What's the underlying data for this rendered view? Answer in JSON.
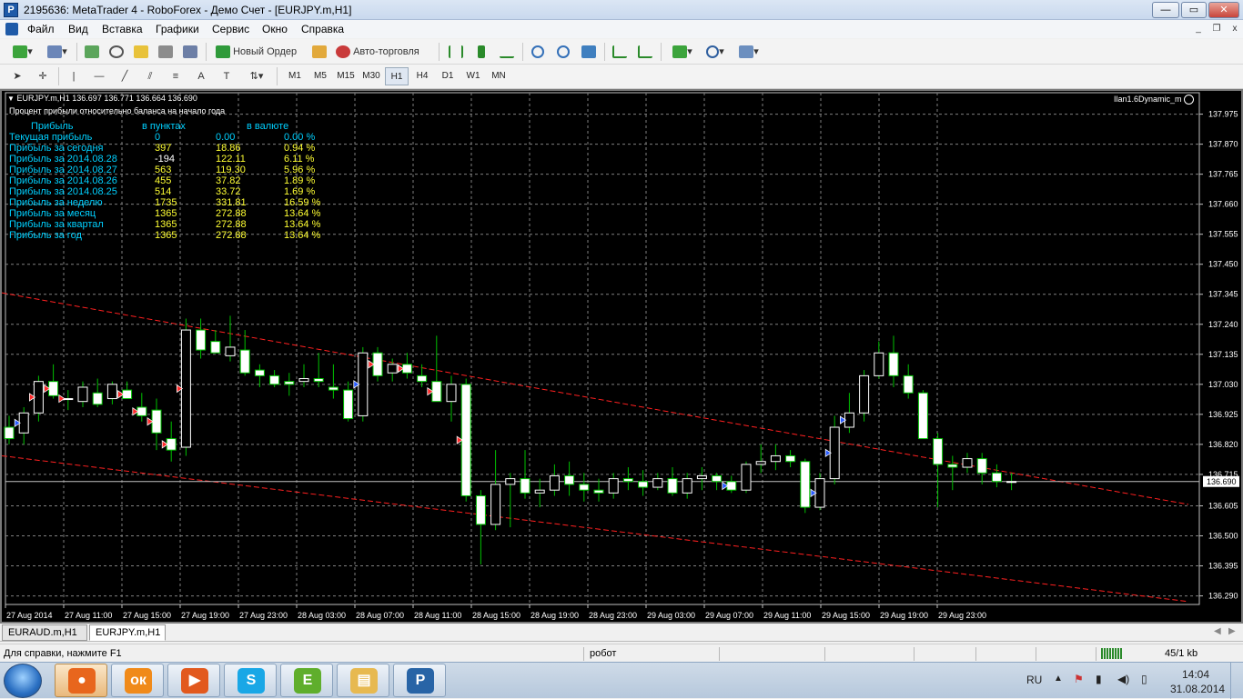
{
  "window": {
    "title": "2195636: MetaTrader 4 - RoboForex - Демо Счет - [EURJPY.m,H1]",
    "app_icon_glyph": "P",
    "minimize_glyph": "—",
    "maximize_glyph": "▭",
    "close_glyph": "✕",
    "mdi_minimize": "_",
    "mdi_restore": "❐",
    "mdi_close": "x"
  },
  "menu": [
    "Файл",
    "Вид",
    "Вставка",
    "Графики",
    "Сервис",
    "Окно",
    "Справка"
  ],
  "toolbar": {
    "new_order": "Новый Ордер",
    "auto_trading": "Авто-торговля",
    "timeframes": [
      "M1",
      "M5",
      "M15",
      "M30",
      "H1",
      "H4",
      "D1",
      "W1",
      "MN"
    ],
    "active_timeframe": "H1",
    "search_value": ""
  },
  "chart": {
    "info_line": "EURJPY.m,H1  136.697 136.771 136.664 136.690",
    "indicator_title": "Процент прибыли относительно баланса на начало года",
    "expert_label": "Ilan1.6Dynamic_m",
    "current_price_label": "136.690"
  },
  "profit_table": {
    "header": [
      "Прибыль",
      "в пунктах",
      "в валюте"
    ],
    "rows": [
      [
        "Текущая прибыль",
        "0",
        "0.00",
        "0.00 %"
      ],
      [
        "Прибыль за сегодня",
        "397",
        "18.86",
        "0.94 %"
      ],
      [
        "Прибыль за 2014.08.28",
        "-194",
        "122.11",
        "6.11 %"
      ],
      [
        "Прибыль за 2014.08.27",
        "563",
        "119.30",
        "5.96 %"
      ],
      [
        "Прибыль за 2014.08.26",
        "455",
        "37.82",
        "1.89 %"
      ],
      [
        "Прибыль за 2014.08.25",
        "514",
        "33.72",
        "1.69 %"
      ],
      [
        "Прибыль за неделю",
        "1735",
        "331.81",
        "16.59 %"
      ],
      [
        "Прибыль за месяц",
        "1365",
        "272.88",
        "13.64 %"
      ],
      [
        "Прибыль за квартал",
        "1365",
        "272.88",
        "13.64 %"
      ],
      [
        "Прибыль за год",
        "1365",
        "272.88",
        "13.64 %"
      ]
    ]
  },
  "chart_data": {
    "type": "candlestick",
    "symbol": "EURJPY.m",
    "timeframe": "H1",
    "y_ticks": [
      "137.975",
      "137.870",
      "137.765",
      "137.660",
      "137.555",
      "137.450",
      "137.345",
      "137.240",
      "137.135",
      "137.030",
      "136.925",
      "136.820",
      "136.715",
      "136.605",
      "136.500",
      "136.395",
      "136.290"
    ],
    "x_ticks": [
      "27 Aug 2014",
      "27 Aug 11:00",
      "27 Aug 15:00",
      "27 Aug 19:00",
      "27 Aug 23:00",
      "28 Aug 03:00",
      "28 Aug 07:00",
      "28 Aug 11:00",
      "28 Aug 15:00",
      "28 Aug 19:00",
      "28 Aug 23:00",
      "29 Aug 03:00",
      "29 Aug 07:00",
      "29 Aug 11:00",
      "29 Aug 15:00",
      "29 Aug 19:00",
      "29 Aug 23:00"
    ],
    "ylim": [
      136.26,
      138.05
    ],
    "grid": true,
    "current_price": 136.69,
    "candles": [
      [
        136.88,
        136.92,
        136.82,
        136.84
      ],
      [
        136.86,
        136.95,
        136.82,
        136.93
      ],
      [
        136.93,
        137.06,
        136.9,
        137.04
      ],
      [
        137.04,
        137.1,
        136.98,
        136.99
      ],
      [
        136.98,
        137.01,
        136.94,
        136.98
      ],
      [
        136.97,
        137.04,
        136.95,
        137.02
      ],
      [
        137.0,
        137.05,
        136.95,
        136.96
      ],
      [
        136.98,
        137.04,
        136.96,
        137.03
      ],
      [
        137.01,
        137.04,
        136.98,
        136.98
      ],
      [
        136.95,
        137.0,
        136.9,
        136.92
      ],
      [
        136.94,
        136.98,
        136.8,
        136.86
      ],
      [
        136.84,
        136.9,
        136.76,
        136.8
      ],
      [
        136.81,
        137.26,
        136.78,
        137.22
      ],
      [
        137.22,
        137.26,
        137.12,
        137.15
      ],
      [
        137.18,
        137.22,
        137.14,
        137.14
      ],
      [
        137.13,
        137.27,
        137.11,
        137.16
      ],
      [
        137.15,
        137.22,
        137.06,
        137.07
      ],
      [
        137.08,
        137.1,
        137.02,
        137.06
      ],
      [
        137.06,
        137.08,
        137.02,
        137.03
      ],
      [
        137.04,
        137.07,
        136.99,
        137.03
      ],
      [
        137.04,
        137.1,
        137.02,
        137.05
      ],
      [
        137.05,
        137.14,
        137.02,
        137.04
      ],
      [
        137.02,
        137.1,
        136.98,
        137.01
      ],
      [
        137.01,
        137.04,
        136.9,
        136.91
      ],
      [
        136.92,
        137.16,
        136.9,
        137.14
      ],
      [
        137.14,
        137.16,
        137.04,
        137.06
      ],
      [
        137.07,
        137.12,
        137.04,
        137.1
      ],
      [
        137.1,
        137.14,
        137.05,
        137.07
      ],
      [
        137.06,
        137.1,
        137.02,
        137.04
      ],
      [
        137.04,
        137.2,
        136.98,
        136.97
      ],
      [
        136.97,
        137.06,
        136.9,
        137.03
      ],
      [
        137.03,
        137.05,
        136.62,
        136.64
      ],
      [
        136.64,
        136.66,
        136.4,
        136.54
      ],
      [
        136.54,
        136.8,
        136.52,
        136.68
      ],
      [
        136.68,
        136.72,
        136.53,
        136.7
      ],
      [
        136.7,
        136.8,
        136.63,
        136.65
      ],
      [
        136.65,
        136.7,
        136.6,
        136.66
      ],
      [
        136.66,
        136.75,
        136.64,
        136.71
      ],
      [
        136.71,
        136.76,
        136.64,
        136.68
      ],
      [
        136.68,
        136.72,
        136.62,
        136.66
      ],
      [
        136.66,
        136.7,
        136.62,
        136.65
      ],
      [
        136.65,
        136.72,
        136.63,
        136.7
      ],
      [
        136.7,
        136.74,
        136.66,
        136.69
      ],
      [
        136.69,
        136.73,
        136.64,
        136.67
      ],
      [
        136.67,
        136.72,
        136.66,
        136.7
      ],
      [
        136.7,
        136.74,
        136.64,
        136.65
      ],
      [
        136.65,
        136.72,
        136.63,
        136.7
      ],
      [
        136.7,
        136.74,
        136.66,
        136.71
      ],
      [
        136.71,
        136.72,
        136.66,
        136.69
      ],
      [
        136.69,
        136.71,
        136.65,
        136.66
      ],
      [
        136.66,
        136.76,
        136.65,
        136.75
      ],
      [
        136.75,
        136.82,
        136.72,
        136.76
      ],
      [
        136.76,
        136.82,
        136.73,
        136.78
      ],
      [
        136.78,
        136.8,
        136.74,
        136.76
      ],
      [
        136.76,
        136.77,
        136.58,
        136.6
      ],
      [
        136.6,
        136.72,
        136.59,
        136.7
      ],
      [
        136.7,
        136.92,
        136.68,
        136.88
      ],
      [
        136.88,
        137.0,
        136.86,
        136.93
      ],
      [
        136.93,
        137.08,
        136.9,
        137.06
      ],
      [
        137.06,
        137.18,
        137.05,
        137.14
      ],
      [
        137.14,
        137.2,
        137.02,
        137.06
      ],
      [
        137.06,
        137.1,
        136.98,
        137.0
      ],
      [
        137.0,
        137.01,
        136.84,
        136.84
      ],
      [
        136.84,
        136.86,
        136.6,
        136.75
      ],
      [
        136.75,
        136.78,
        136.66,
        136.74
      ],
      [
        136.74,
        136.79,
        136.72,
        136.77
      ],
      [
        136.77,
        136.79,
        136.68,
        136.72
      ],
      [
        136.72,
        136.75,
        136.67,
        136.69
      ],
      [
        136.69,
        136.72,
        136.66,
        136.69
      ]
    ],
    "trendlines": [
      {
        "from": [
          0,
          137.35
        ],
        "to": [
          80,
          136.61
        ],
        "color": "#ff2020"
      },
      {
        "from": [
          0,
          136.78
        ],
        "to": [
          80,
          136.27
        ],
        "color": "#ff2020"
      }
    ]
  },
  "chart_tabs": [
    "EURAUD.m,H1",
    "EURJPY.m,H1"
  ],
  "active_chart_tab": "EURJPY.m,H1",
  "status": {
    "help": "Для справки, нажмите F1",
    "profile": "робот",
    "traffic": "45/1 kb"
  },
  "taskbar": {
    "apps": [
      {
        "name": "firefox",
        "glyph": "●",
        "color": "#e8661d"
      },
      {
        "name": "odnoklassniki",
        "glyph": "ок",
        "color": "#f08a1a"
      },
      {
        "name": "media-player",
        "glyph": "▶",
        "color": "#e2591e"
      },
      {
        "name": "skype",
        "glyph": "S",
        "color": "#19a7e6"
      },
      {
        "name": "evernote",
        "glyph": "E",
        "color": "#5fae2c"
      },
      {
        "name": "explorer",
        "glyph": "▤",
        "color": "#e7b950"
      },
      {
        "name": "metatrader",
        "glyph": "P",
        "color": "#2864a6"
      }
    ],
    "language": "RU",
    "time": "14:04",
    "date": "31.08.2014"
  },
  "colors": {
    "chart_bg": "#000000",
    "grid": "#808080",
    "bull": "#ffffff",
    "bear": "#ffffff",
    "wick": "#00c000",
    "profit_label": "#00d0ff",
    "profit_value": "#ffff33",
    "current_line": "#c0c0c0"
  }
}
